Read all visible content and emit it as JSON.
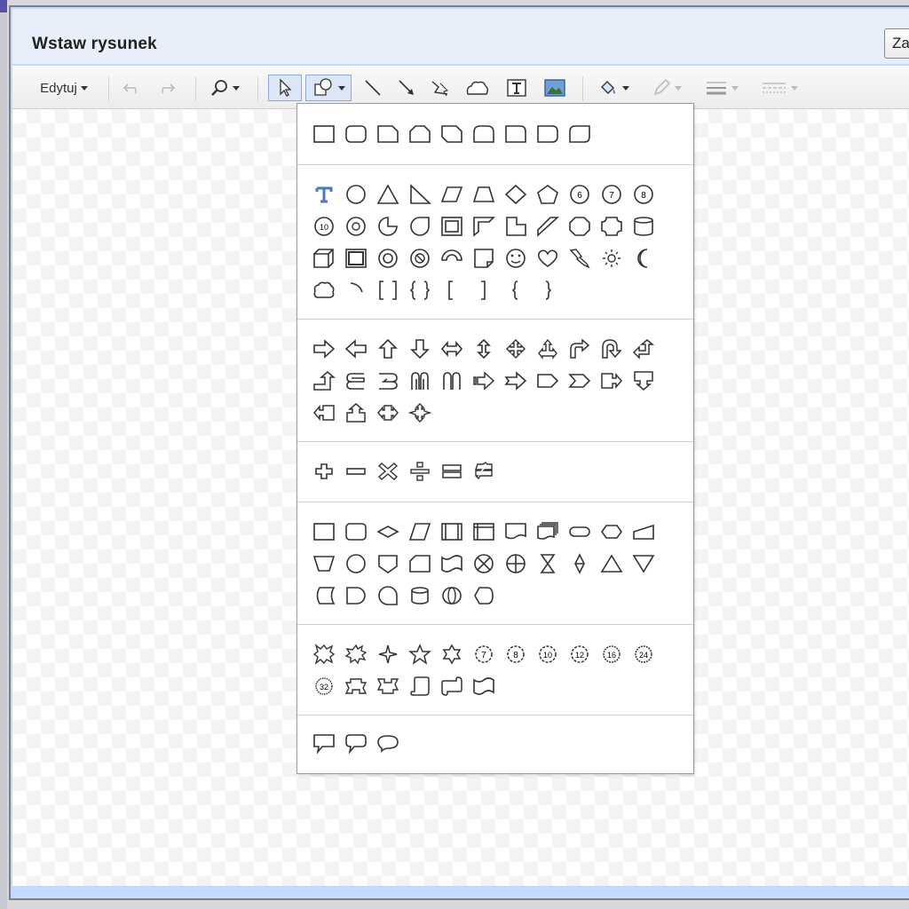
{
  "dialog": {
    "title": "Wstaw rysunek",
    "close_label": "Za"
  },
  "toolbar": {
    "edit_menu_label": "Edytuj",
    "buttons": [
      {
        "name": "undo-button",
        "icon": "undo-icon",
        "enabled": false
      },
      {
        "name": "redo-button",
        "icon": "redo-icon",
        "enabled": false
      },
      {
        "name": "zoom-button",
        "icon": "zoom-icon",
        "dropdown": true
      },
      {
        "name": "select-button",
        "icon": "pointer-icon",
        "active": true
      },
      {
        "name": "shape-button",
        "icon": "shape-icon",
        "dropdown": true,
        "active": true
      },
      {
        "name": "line-button",
        "icon": "line-icon"
      },
      {
        "name": "arrow-button",
        "icon": "arrow-line-icon"
      },
      {
        "name": "polyline-button",
        "icon": "polyline-icon"
      },
      {
        "name": "freeform-button",
        "icon": "freeform-icon"
      },
      {
        "name": "textbox-button",
        "icon": "textbox-icon"
      },
      {
        "name": "image-button",
        "icon": "image-icon"
      },
      {
        "name": "fill-color-button",
        "icon": "paint-bucket-icon",
        "dropdown": true
      },
      {
        "name": "line-color-button",
        "icon": "pencil-icon",
        "dropdown": true,
        "enabled": false
      },
      {
        "name": "line-weight-button",
        "icon": "line-weight-icon",
        "dropdown": true,
        "enabled": false
      },
      {
        "name": "line-dash-button",
        "icon": "line-dash-icon",
        "dropdown": true,
        "enabled": false
      }
    ]
  },
  "colors": {
    "accent": "#5b83d4",
    "text_icon": "#4a78c2",
    "border": "#9a9a9a",
    "title_bg": "#e8effb",
    "dialog_frame": "#c3d9ff"
  },
  "shape_menu": {
    "groups": [
      {
        "name": "rectangles",
        "shapes": [
          "rectangle",
          "rounded-rectangle",
          "snip-corner-rectangle",
          "snip-two-corners-rectangle",
          "snip-diagonal-rectangle",
          "round-two-corners-rectangle",
          "round-corner-rectangle",
          "round-same-side-rectangle",
          "round-diagonal-rectangle"
        ]
      },
      {
        "name": "basic-shapes",
        "shapes": [
          "text-box",
          "ellipse",
          "triangle",
          "right-triangle",
          "parallelogram",
          "trapezoid",
          "diamond",
          "pentagon",
          "hexagon",
          "heptagon",
          "octagon",
          "decagon",
          "dodecagon",
          "pie",
          "chord",
          "teardrop",
          "frame",
          "half-frame",
          "l-shape",
          "diagonal-stripe",
          "plus-cross",
          "plaque",
          "can",
          "cube",
          "bevel",
          "donut",
          "no-symbol",
          "block-arc",
          "folded-corner",
          "smiley-face",
          "heart",
          "lightning-bolt",
          "sun",
          "moon",
          "cloud",
          "arc",
          "double-bracket",
          "double-brace",
          "left-bracket",
          "right-bracket",
          "left-brace",
          "right-brace"
        ]
      },
      {
        "name": "block-arrows",
        "shapes": [
          "right-arrow",
          "left-arrow",
          "up-arrow",
          "down-arrow",
          "left-right-arrow",
          "up-down-arrow",
          "quad-arrow",
          "left-right-up-arrow",
          "bent-arrow",
          "u-turn-arrow",
          "left-up-arrow",
          "bent-up-arrow",
          "curved-right-arrow",
          "curved-left-arrow",
          "curved-up-arrow",
          "curved-down-arrow",
          "striped-right-arrow",
          "notched-right-arrow",
          "pentagon-arrow",
          "chevron",
          "right-arrow-callout",
          "down-arrow-callout",
          "left-arrow-callout",
          "up-arrow-callout",
          "left-right-arrow-callout",
          "quad-arrow-callout"
        ]
      },
      {
        "name": "equation-shapes",
        "shapes": [
          "plus",
          "minus",
          "multiply",
          "divide",
          "equal",
          "not-equal"
        ]
      },
      {
        "name": "flowchart",
        "shapes": [
          "process",
          "alternate-process",
          "decision",
          "data",
          "predefined-process",
          "internal-storage",
          "document",
          "multidocument",
          "terminator",
          "preparation",
          "manual-input",
          "manual-operation",
          "connector",
          "off-page-connector",
          "card",
          "punched-tape",
          "summing-junction",
          "or",
          "collate",
          "sort",
          "extract",
          "merge",
          "stored-data",
          "delay",
          "sequential-access-storage",
          "magnetic-disk",
          "direct-access-storage",
          "display"
        ]
      },
      {
        "name": "stars-and-banners",
        "shapes": [
          "explosion-1",
          "explosion-2",
          "4-point-star",
          "5-point-star",
          "6-point-star",
          "7-point-star",
          "8-point-star",
          "10-point-star",
          "12-point-star",
          "16-point-star",
          "24-point-star",
          "32-point-star",
          "ribbon-up",
          "ribbon-down",
          "vertical-scroll",
          "horizontal-scroll",
          "wave"
        ]
      },
      {
        "name": "callouts",
        "shapes": [
          "rectangular-callout",
          "rounded-rectangular-callout",
          "oval-callout"
        ]
      }
    ]
  }
}
